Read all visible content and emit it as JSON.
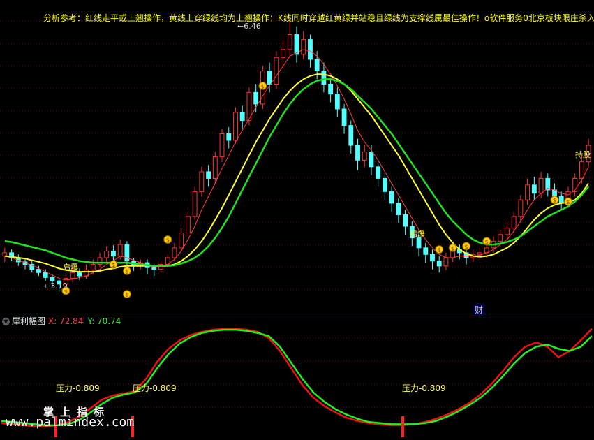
{
  "annotations": {
    "analysis_text": "分析参考：红线走平或上翘操作，黄线上穿绿线均为上翘操作；K线同时穿越红黄绿并站稳且绿线为支撑线属最佳操作！o软件服务0北京板块限庄杀入",
    "high_price": "6.46",
    "low_price": "3.19",
    "cai": "财",
    "qibao": "启爆",
    "chixu": "持股"
  },
  "indicator": {
    "name": "犀利幅图",
    "x_label": "X: 72.84",
    "y_label": "Y: 70.74",
    "pressure_labels": [
      "压力-0.809",
      "压力-0.809",
      "压力-0.809"
    ]
  },
  "watermark": {
    "cn": "掌上指标",
    "url": "www.palmindex.com"
  },
  "colors": {
    "up": "#54ffff",
    "down": "#00ffff",
    "rise": "#ff3232",
    "red_line": "#ff4040",
    "yellow_line": "#ffff33",
    "green_line": "#22e022",
    "ind_red": "#ee1111",
    "ind_green": "#22ee22",
    "grid": "#800000",
    "signal_icon": "#ffcc00"
  },
  "chart_data": [
    {
      "type": "candlestick",
      "title": "",
      "ylim": [
        3.0,
        6.6
      ],
      "high": 6.46,
      "low": 3.19,
      "candles": [
        [
          3.62,
          3.66,
          3.55,
          3.72
        ],
        [
          3.66,
          3.6,
          3.56,
          3.7
        ],
        [
          3.6,
          3.55,
          3.5,
          3.64
        ],
        [
          3.55,
          3.52,
          3.46,
          3.6
        ],
        [
          3.52,
          3.46,
          3.42,
          3.56
        ],
        [
          3.46,
          3.42,
          3.38,
          3.5
        ],
        [
          3.42,
          3.36,
          3.32,
          3.46
        ],
        [
          3.36,
          3.32,
          3.24,
          3.4
        ],
        [
          3.32,
          3.28,
          3.19,
          3.36
        ],
        [
          3.28,
          3.35,
          3.24,
          3.4
        ],
        [
          3.35,
          3.42,
          3.3,
          3.48
        ],
        [
          3.42,
          3.38,
          3.33,
          3.47
        ],
        [
          3.38,
          3.45,
          3.34,
          3.52
        ],
        [
          3.45,
          3.52,
          3.4,
          3.58
        ],
        [
          3.52,
          3.6,
          3.48,
          3.66
        ],
        [
          3.6,
          3.68,
          3.55,
          3.74
        ],
        [
          3.68,
          3.62,
          3.55,
          3.75
        ],
        [
          3.62,
          3.76,
          3.58,
          3.82
        ],
        [
          3.76,
          3.56,
          3.5,
          3.8
        ],
        [
          3.56,
          3.5,
          3.44,
          3.6
        ],
        [
          3.5,
          3.54,
          3.46,
          3.58
        ],
        [
          3.54,
          3.48,
          3.4,
          3.58
        ],
        [
          3.48,
          3.46,
          3.38,
          3.52
        ],
        [
          3.46,
          3.52,
          3.42,
          3.56
        ],
        [
          3.52,
          3.6,
          3.48,
          3.64
        ],
        [
          3.6,
          3.72,
          3.56,
          3.78
        ],
        [
          3.72,
          3.9,
          3.68,
          3.96
        ],
        [
          3.9,
          4.1,
          3.86,
          4.16
        ],
        [
          4.1,
          4.4,
          4.06,
          4.46
        ],
        [
          4.4,
          4.64,
          4.34,
          4.7
        ],
        [
          4.64,
          4.56,
          4.46,
          4.72
        ],
        [
          4.56,
          4.82,
          4.5,
          4.88
        ],
        [
          4.82,
          5.1,
          4.76,
          5.16
        ],
        [
          5.1,
          5.02,
          4.92,
          5.18
        ],
        [
          5.02,
          5.36,
          4.98,
          5.42
        ],
        [
          5.36,
          5.26,
          5.16,
          5.44
        ],
        [
          5.26,
          5.6,
          5.2,
          5.66
        ],
        [
          5.6,
          5.46,
          5.36,
          5.7
        ],
        [
          5.46,
          5.86,
          5.4,
          5.92
        ],
        [
          5.86,
          5.7,
          5.6,
          5.96
        ],
        [
          5.7,
          6.02,
          5.64,
          6.1
        ],
        [
          6.02,
          6.12,
          5.9,
          6.24
        ],
        [
          6.12,
          6.3,
          6.02,
          6.46
        ],
        [
          6.3,
          6.06,
          5.96,
          6.4
        ],
        [
          6.06,
          6.24,
          6.0,
          6.34
        ],
        [
          6.24,
          6.0,
          5.9,
          6.3
        ],
        [
          6.0,
          5.86,
          5.76,
          6.1
        ],
        [
          5.86,
          5.7,
          5.6,
          5.96
        ],
        [
          5.7,
          5.58,
          5.48,
          5.78
        ],
        [
          5.58,
          5.4,
          5.3,
          5.66
        ],
        [
          5.4,
          5.2,
          5.1,
          5.46
        ],
        [
          5.2,
          4.96,
          4.86,
          5.26
        ],
        [
          4.96,
          4.78,
          4.66,
          5.04
        ],
        [
          4.78,
          4.88,
          4.7,
          4.96
        ],
        [
          4.88,
          4.7,
          4.6,
          4.96
        ],
        [
          4.7,
          4.56,
          4.46,
          4.76
        ],
        [
          4.56,
          4.4,
          4.3,
          4.62
        ],
        [
          4.4,
          4.26,
          4.16,
          4.46
        ],
        [
          4.26,
          4.12,
          4.02,
          4.32
        ],
        [
          4.12,
          3.98,
          3.88,
          4.18
        ],
        [
          3.98,
          3.84,
          3.74,
          4.04
        ],
        [
          3.84,
          3.72,
          3.62,
          3.9
        ],
        [
          3.72,
          3.64,
          3.54,
          3.78
        ],
        [
          3.64,
          3.56,
          3.46,
          3.7
        ],
        [
          3.56,
          3.5,
          3.42,
          3.62
        ],
        [
          3.5,
          3.6,
          3.45,
          3.66
        ],
        [
          3.6,
          3.7,
          3.55,
          3.76
        ],
        [
          3.7,
          3.66,
          3.58,
          3.76
        ],
        [
          3.66,
          3.6,
          3.52,
          3.7
        ],
        [
          3.6,
          3.64,
          3.55,
          3.7
        ],
        [
          3.64,
          3.66,
          3.58,
          3.72
        ],
        [
          3.66,
          3.72,
          3.6,
          3.78
        ],
        [
          3.72,
          3.8,
          3.66,
          3.86
        ],
        [
          3.8,
          3.88,
          3.74,
          3.94
        ],
        [
          3.88,
          3.96,
          3.82,
          4.02
        ],
        [
          3.96,
          4.1,
          3.9,
          4.16
        ],
        [
          4.1,
          4.3,
          4.04,
          4.36
        ],
        [
          4.3,
          4.48,
          4.24,
          4.56
        ],
        [
          4.48,
          4.38,
          4.3,
          4.58
        ],
        [
          4.38,
          4.56,
          4.32,
          4.64
        ],
        [
          4.56,
          4.42,
          4.34,
          4.62
        ],
        [
          4.42,
          4.34,
          4.26,
          4.5
        ],
        [
          4.34,
          4.26,
          4.18,
          4.4
        ],
        [
          4.26,
          4.4,
          4.2,
          4.46
        ],
        [
          4.4,
          4.56,
          4.34,
          4.62
        ],
        [
          4.56,
          4.76,
          4.5,
          4.84
        ],
        [
          4.76,
          4.96,
          4.7,
          5.04
        ]
      ],
      "ma_red": [
        3.62,
        3.6,
        3.57,
        3.54,
        3.51,
        3.47,
        3.43,
        3.39,
        3.35,
        3.33,
        3.34,
        3.36,
        3.38,
        3.42,
        3.46,
        3.52,
        3.56,
        3.62,
        3.6,
        3.57,
        3.54,
        3.51,
        3.49,
        3.49,
        3.52,
        3.58,
        3.68,
        3.82,
        3.98,
        4.18,
        4.34,
        4.5,
        4.68,
        4.84,
        5.0,
        5.14,
        5.28,
        5.42,
        5.56,
        5.68,
        5.8,
        5.92,
        6.04,
        6.08,
        6.12,
        6.1,
        6.04,
        5.94,
        5.82,
        5.68,
        5.52,
        5.34,
        5.14,
        5.0,
        4.9,
        4.78,
        4.64,
        4.5,
        4.36,
        4.22,
        4.08,
        3.94,
        3.82,
        3.72,
        3.64,
        3.6,
        3.6,
        3.62,
        3.62,
        3.62,
        3.63,
        3.66,
        3.7,
        3.76,
        3.82,
        3.92,
        4.04,
        4.18,
        4.3,
        4.38,
        4.44,
        4.42,
        4.38,
        4.36,
        4.42,
        4.54,
        4.7
      ],
      "ma_yellow": [
        3.62,
        3.61,
        3.6,
        3.59,
        3.57,
        3.55,
        3.53,
        3.5,
        3.47,
        3.45,
        3.44,
        3.43,
        3.43,
        3.43,
        3.44,
        3.46,
        3.47,
        3.49,
        3.5,
        3.5,
        3.5,
        3.5,
        3.5,
        3.5,
        3.5,
        3.52,
        3.56,
        3.62,
        3.7,
        3.8,
        3.92,
        4.06,
        4.2,
        4.36,
        4.52,
        4.68,
        4.84,
        5.0,
        5.14,
        5.28,
        5.4,
        5.52,
        5.62,
        5.7,
        5.76,
        5.8,
        5.82,
        5.82,
        5.8,
        5.76,
        5.7,
        5.62,
        5.52,
        5.42,
        5.32,
        5.2,
        5.08,
        4.96,
        4.84,
        4.7,
        4.56,
        4.42,
        4.28,
        4.14,
        4.0,
        3.88,
        3.78,
        3.7,
        3.65,
        3.62,
        3.61,
        3.62,
        3.64,
        3.68,
        3.72,
        3.78,
        3.86,
        3.96,
        4.06,
        4.14,
        4.2,
        4.24,
        4.26,
        4.27,
        4.3,
        4.38,
        4.5
      ],
      "ma_green": [
        3.8,
        3.79,
        3.77,
        3.75,
        3.73,
        3.71,
        3.69,
        3.66,
        3.63,
        3.6,
        3.58,
        3.56,
        3.55,
        3.54,
        3.54,
        3.54,
        3.54,
        3.54,
        3.54,
        3.53,
        3.52,
        3.51,
        3.5,
        3.5,
        3.5,
        3.51,
        3.53,
        3.56,
        3.6,
        3.66,
        3.74,
        3.84,
        3.96,
        4.1,
        4.26,
        4.42,
        4.58,
        4.74,
        4.9,
        5.06,
        5.2,
        5.34,
        5.46,
        5.56,
        5.64,
        5.7,
        5.74,
        5.76,
        5.76,
        5.74,
        5.7,
        5.64,
        5.56,
        5.48,
        5.4,
        5.3,
        5.2,
        5.1,
        4.98,
        4.86,
        4.74,
        4.62,
        4.5,
        4.38,
        4.26,
        4.14,
        4.04,
        3.96,
        3.88,
        3.82,
        3.78,
        3.76,
        3.76,
        3.77,
        3.79,
        3.82,
        3.86,
        3.92,
        3.98,
        4.04,
        4.1,
        4.14,
        4.18,
        4.22,
        4.28,
        4.36,
        4.46
      ]
    },
    {
      "type": "line",
      "title": "犀利幅图",
      "ylim": [
        0,
        100
      ],
      "series": [
        {
          "name": "X",
          "values": [
            8,
            7,
            6,
            5,
            5,
            6,
            9,
            14,
            22,
            30,
            34,
            36,
            38,
            50,
            66,
            78,
            86,
            91,
            94,
            96,
            97,
            97,
            96,
            94,
            88,
            76,
            60,
            44,
            32,
            24,
            18,
            13,
            10,
            8,
            7,
            6,
            6,
            7,
            9,
            12,
            16,
            21,
            27,
            35,
            45,
            57,
            70,
            80,
            84,
            80,
            70,
            76,
            86,
            97
          ]
        },
        {
          "name": "Y",
          "values": [
            10,
            9,
            8,
            7,
            6,
            6,
            7,
            11,
            18,
            26,
            32,
            35,
            37,
            45,
            60,
            73,
            83,
            89,
            93,
            95,
            96,
            96,
            95,
            93,
            90,
            80,
            65,
            50,
            37,
            28,
            21,
            16,
            12,
            9,
            8,
            7,
            7,
            7,
            8,
            10,
            14,
            19,
            25,
            32,
            41,
            52,
            64,
            74,
            80,
            82,
            78,
            76,
            80,
            90
          ]
        }
      ],
      "pressure_level": -0.809
    }
  ]
}
